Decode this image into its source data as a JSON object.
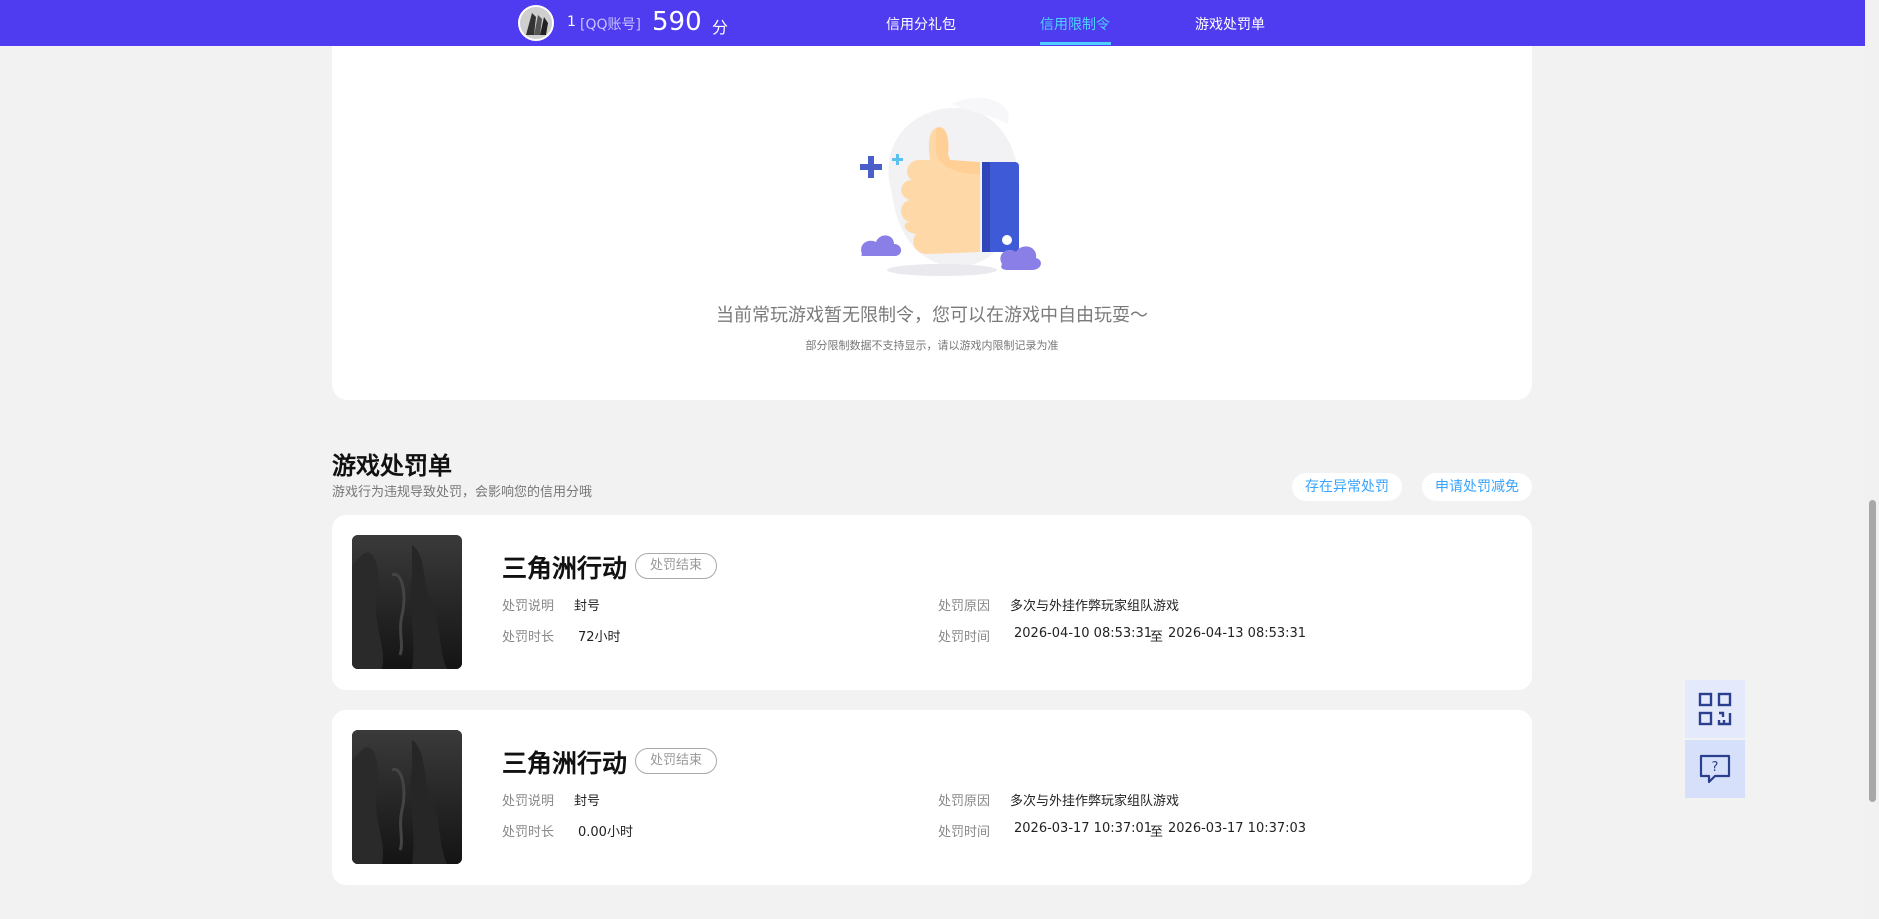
{
  "header": {
    "account_number": "1",
    "account_type": "[QQ账号]",
    "score": "590",
    "score_unit": "分",
    "nav": [
      {
        "label": "信用分礼包"
      },
      {
        "label": "信用限制令"
      },
      {
        "label": "游戏处罚单"
      }
    ]
  },
  "restriction": {
    "empty_title": "当前常玩游戏暂无限制令，您可以在游戏中自由玩耍～",
    "empty_subtitle": "部分限制数据不支持显示，请以游戏内限制记录为准"
  },
  "penalties": {
    "title": "游戏处罚单",
    "subtitle": "游戏行为违规导致处罚，会影响您的信用分哦",
    "abnormal_button": "存在异常处罚",
    "reduce_button": "申请处罚减免",
    "labels": {
      "desc": "处罚说明",
      "duration": "处罚时长",
      "reason": "处罚原因",
      "time": "处罚时间",
      "to": "至"
    },
    "items": [
      {
        "game": "三角洲行动",
        "status": "处罚结束",
        "desc": "封号",
        "duration": "72小时",
        "reason": "多次与外挂作弊玩家组队游戏",
        "start": "2026-04-10 08:53:31",
        "end": "2026-04-13 08:53:31"
      },
      {
        "game": "三角洲行动",
        "status": "处罚结束",
        "desc": "封号",
        "duration": "0.00小时",
        "reason": "多次与外挂作弊玩家组队游戏",
        "start": "2026-03-17 10:37:01",
        "end": "2026-03-17 10:37:03"
      }
    ]
  },
  "floating": {
    "qr_icon": "qrcode-icon",
    "help_icon": "help-chat-icon"
  },
  "colors": {
    "topbar": "#4f3bf0",
    "active_nav": "#4fd0ff",
    "pill_text": "#3aa4ff",
    "float_bg": "#d7e0fa"
  }
}
